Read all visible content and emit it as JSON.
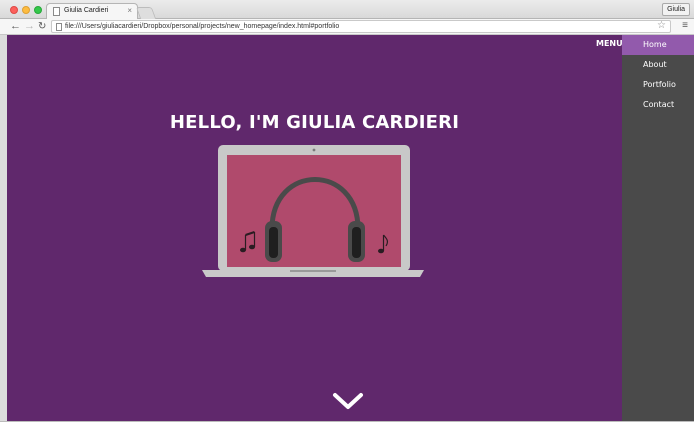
{
  "browser": {
    "tab_title": "Giulia Cardieri",
    "tab_close": "×",
    "profile_label": "Giulia",
    "url": "file:///Users/giuliacardieri/Dropbox/personal/projects/new_homepage/index.html#portfolio",
    "back_glyph": "←",
    "forward_glyph": "→",
    "reload_glyph": "↻",
    "star_glyph": "☆",
    "menu_glyph": "≡",
    "icons": [
      "page-icon",
      "back-arrow-icon",
      "forward-arrow-icon",
      "reload-icon",
      "bookmark-star-icon",
      "hamburger-menu-icon"
    ]
  },
  "page": {
    "background_color": "#60286c",
    "menu_label": "MENU",
    "hero_title": "HELLO, I'M GIULIA CARDIERI",
    "illustration": "laptop-with-headphones-and-music-notes",
    "scroll_indicator": "chevron-down-icon"
  },
  "sidebar": {
    "background_color": "#4a4a4a",
    "active_color": "#925aac",
    "items": [
      {
        "label": "Home",
        "active": true
      },
      {
        "label": "About",
        "active": false
      },
      {
        "label": "Portfolio",
        "active": false
      },
      {
        "label": "Contact",
        "active": false
      }
    ]
  }
}
